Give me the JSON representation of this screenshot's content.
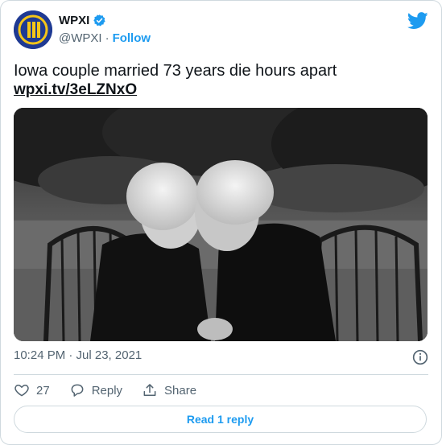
{
  "account": {
    "name": "WPXI",
    "handle": "@WPXI",
    "separator": "·",
    "follow_label": "Follow"
  },
  "tweet": {
    "text": "Iowa couple married 73 years die hours apart",
    "link": "wpxi.tv/3eLZNxO",
    "timestamp": "10:24 PM · Jul 23, 2021"
  },
  "actions": {
    "like_count": "27",
    "reply_label": "Reply",
    "share_label": "Share"
  },
  "read_replies_label": "Read 1 reply",
  "colors": {
    "accent": "#1d9bf0",
    "avatar_bg": "#1f3a93",
    "avatar_mark": "#f5c518",
    "text": "#0f1419",
    "muted": "#536471",
    "border": "#cfd9de"
  },
  "icons": {
    "verified": "verified-badge-icon",
    "brand": "twitter-bird-icon",
    "info": "info-icon",
    "like": "heart-icon",
    "reply": "reply-bubble-icon",
    "share": "share-upload-icon"
  }
}
